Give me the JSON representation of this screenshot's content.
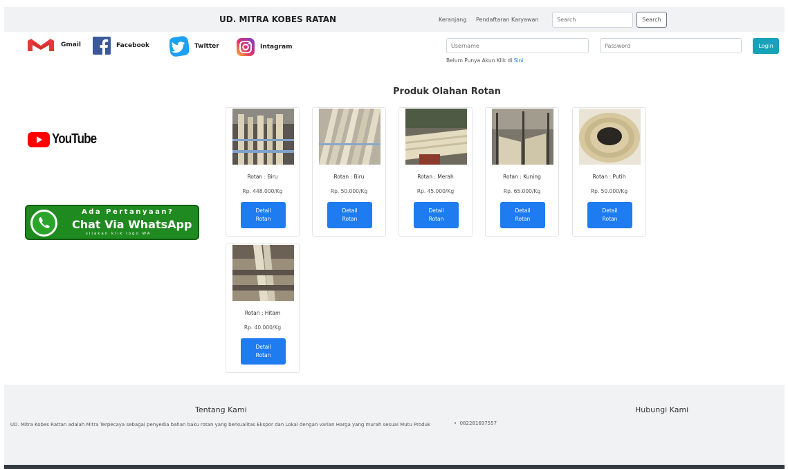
{
  "navbar": {
    "brand": "UD. MITRA KOBES RATAN",
    "links": [
      "Keranjang",
      "Pendaftaran Karyawan"
    ],
    "search_placeholder": "Search",
    "search_button": "Search"
  },
  "social": [
    {
      "label": "Gmail",
      "icon": "gmail-icon"
    },
    {
      "label": "Facebook",
      "icon": "facebook-icon"
    },
    {
      "label": "Twitter",
      "icon": "twitter-icon"
    },
    {
      "label": "Intagram",
      "icon": "instagram-icon"
    }
  ],
  "login": {
    "username_placeholder": "Username",
    "password_placeholder": "Password",
    "button": "Login",
    "register_text": "Belum Punya Akun Klik di ",
    "register_link": "Sini"
  },
  "side": {
    "youtube": "YouTube",
    "whatsapp": {
      "line1": "Ada Pertanyaan?",
      "line2": "Chat Via WhatsApp",
      "line3": "silakan klik logo WA"
    }
  },
  "products": {
    "title": "Produk Olahan Rotan",
    "items": [
      {
        "name": "Rotan : Biru",
        "price": "Rp. 448.000/Kg",
        "button": "Detail\nRotan"
      },
      {
        "name": "Rotan : Biru",
        "price": "Rp. 50.000/Kg",
        "button": "Detail\nRotan"
      },
      {
        "name": "Rotan : Merah",
        "price": "Rp. 45.000/Kg",
        "button": "Detail\nRotan"
      },
      {
        "name": "Rotan : Kuning",
        "price": "Rp. 65.000/Kg",
        "button": "Detail\nRotan"
      },
      {
        "name": "Rotan : Putih",
        "price": "Rp. 50.000/Kg",
        "button": "Detail\nRotan"
      },
      {
        "name": "Rotan : Hitam",
        "price": "Rp. 40.000/Kg",
        "button": "Detail\nRotan"
      }
    ]
  },
  "footer": {
    "about_title": "Tentang Kami",
    "about_text": "UD. Mitra Kobes Rattan adalah Mitra Terpecaya sebagai penyedia bahan baku rotan yang berkualitas Ekspor dan Lokal dengan varian Harga yang murah sesuai Mutu Produk",
    "contact_title": "Hubungi Kami",
    "phone": "082281697557"
  },
  "colors": {
    "primary": "#1e7bf0",
    "login": "#17a2b8",
    "whatsapp": "#1f8a1f",
    "youtube": "#ff0000"
  }
}
